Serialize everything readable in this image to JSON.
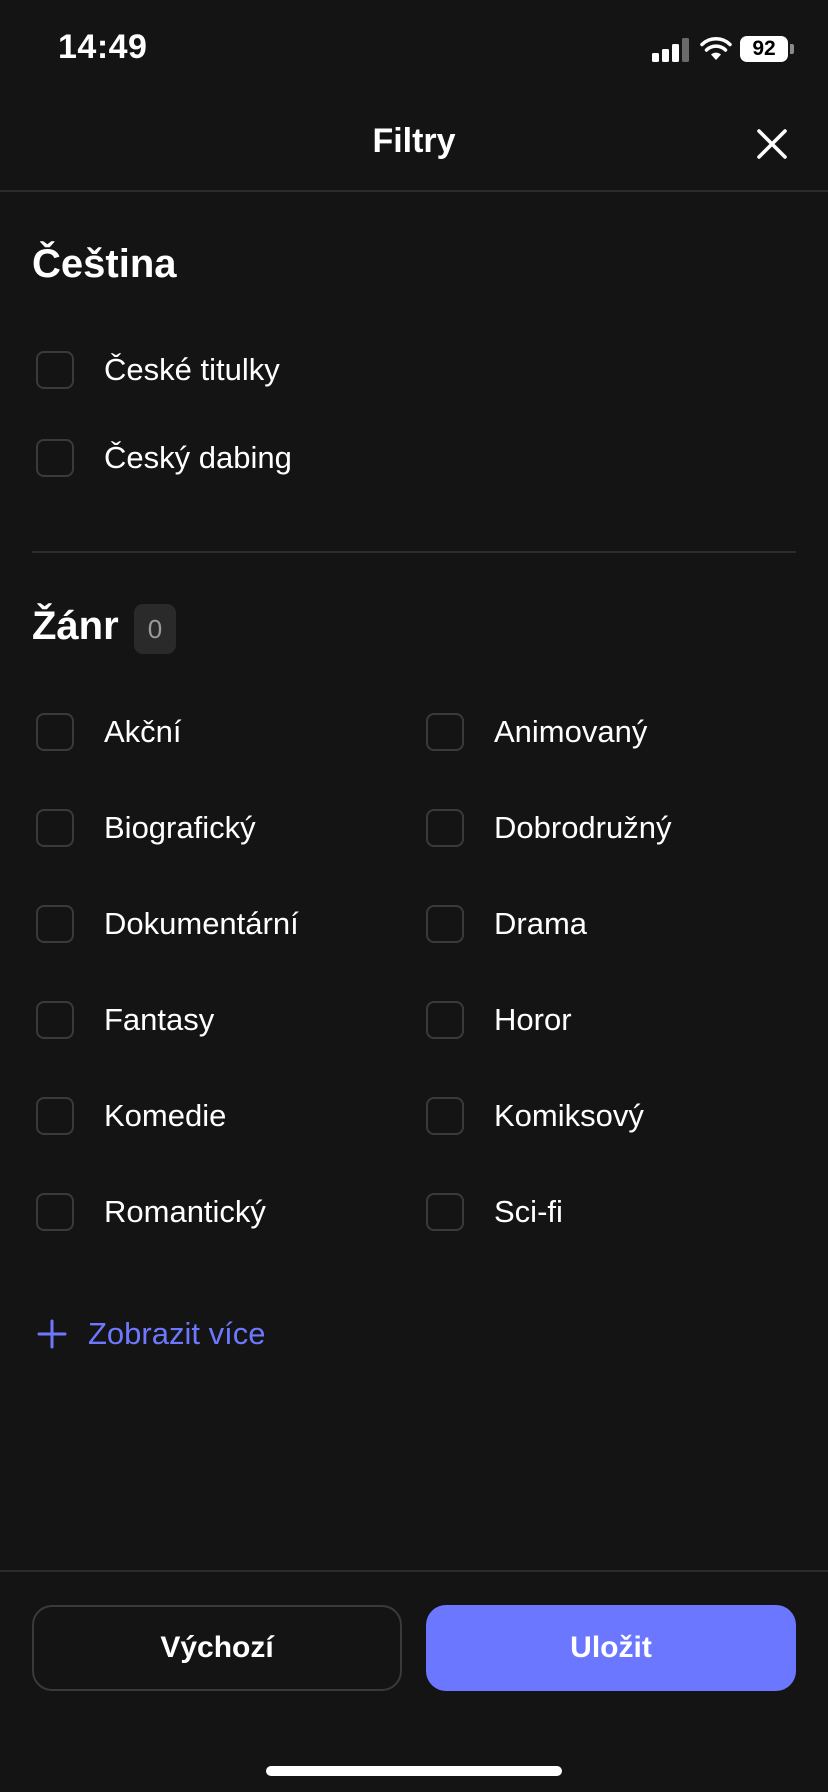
{
  "status_bar": {
    "time": "14:49",
    "battery": "92",
    "icons": [
      "signal-icon",
      "wifi-icon",
      "battery-icon"
    ]
  },
  "header": {
    "title": "Filtry",
    "close_icon": "close-icon"
  },
  "language_section": {
    "title": "Čeština",
    "options": [
      {
        "label": "České titulky",
        "checked": false
      },
      {
        "label": "Český dabing",
        "checked": false
      }
    ]
  },
  "genre_section": {
    "title": "Žánr",
    "selected_count": "0",
    "options": [
      {
        "label": "Akční",
        "checked": false
      },
      {
        "label": "Animovaný",
        "checked": false
      },
      {
        "label": "Biografický",
        "checked": false
      },
      {
        "label": "Dobrodružný",
        "checked": false
      },
      {
        "label": "Dokumentární",
        "checked": false
      },
      {
        "label": "Drama",
        "checked": false
      },
      {
        "label": "Fantasy",
        "checked": false
      },
      {
        "label": "Horor",
        "checked": false
      },
      {
        "label": "Komedie",
        "checked": false
      },
      {
        "label": "Komiksový",
        "checked": false
      },
      {
        "label": "Romantický",
        "checked": false
      },
      {
        "label": "Sci-fi",
        "checked": false
      }
    ],
    "show_more_label": "Zobrazit více",
    "show_more_icon": "plus-icon"
  },
  "footer": {
    "default_label": "Výchozí",
    "save_label": "Uložit"
  },
  "colors": {
    "background": "#141414",
    "accent": "#6c77ff",
    "link": "#6e78ff",
    "divider": "#2c2c2c"
  }
}
